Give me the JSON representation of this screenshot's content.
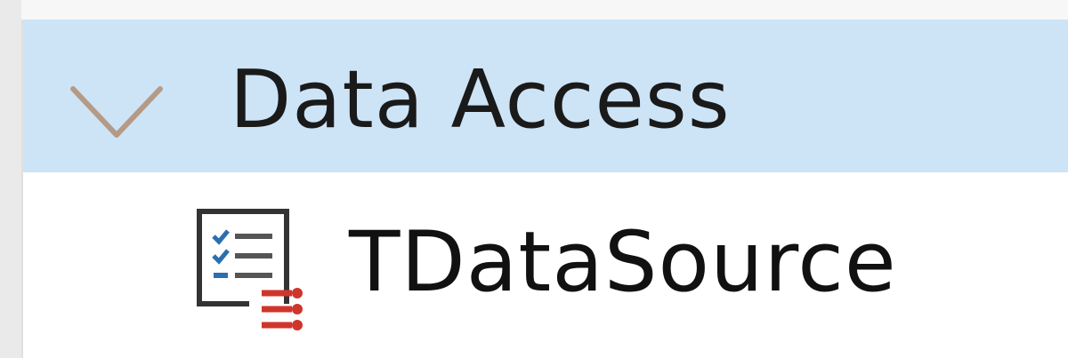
{
  "category": {
    "label": "Data Access",
    "expanded": true,
    "icon": "chevron-down-icon"
  },
  "components": [
    {
      "label": "TDataSource",
      "icon": "datasource-icon"
    }
  ],
  "colors": {
    "header_bg": "#cde4f7",
    "chevron": "#b59a86",
    "icon_blue": "#2b6fb0",
    "icon_red": "#d0352b",
    "text": "#1a1a1a"
  }
}
